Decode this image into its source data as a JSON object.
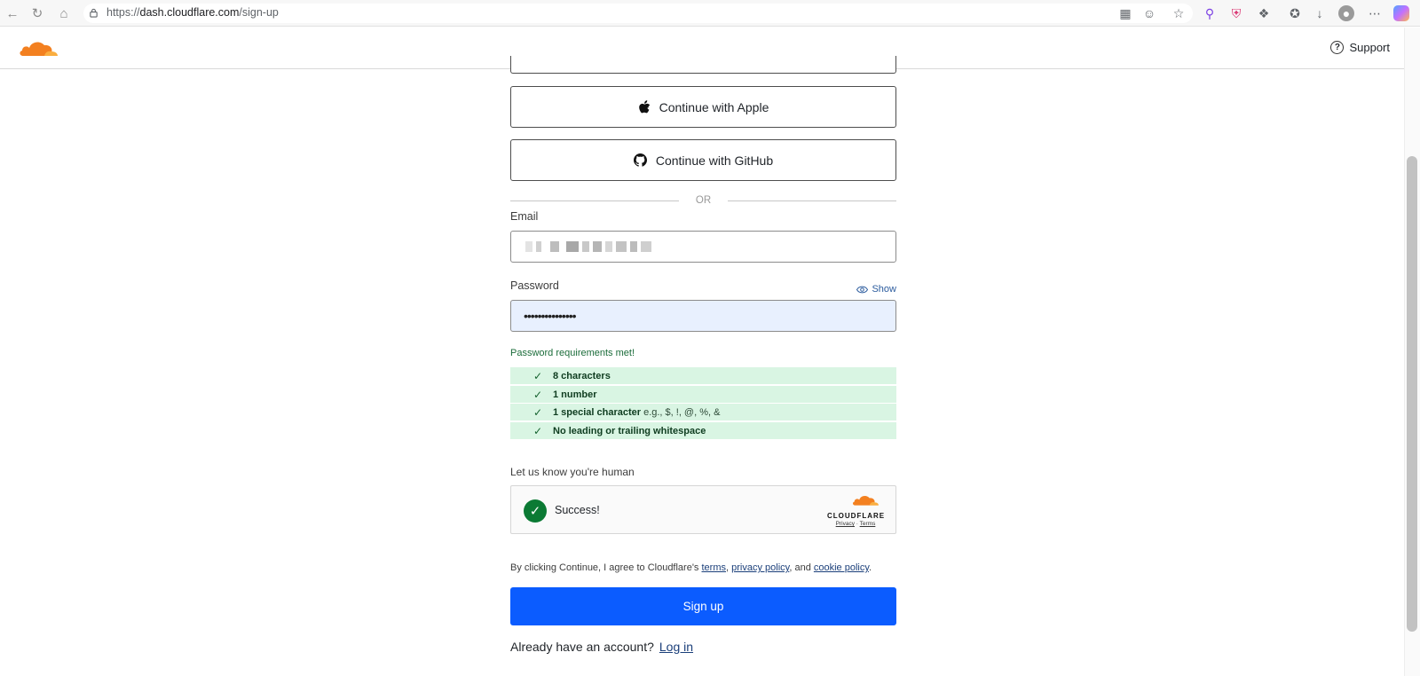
{
  "browser": {
    "url_scheme": "https://",
    "url_host": "dash.cloudflare.com",
    "url_path": "/sign-up"
  },
  "header": {
    "support_label": "Support"
  },
  "auth": {
    "apple_label": "Continue with Apple",
    "github_label": "Continue with GitHub",
    "divider_text": "OR"
  },
  "email": {
    "label": "Email"
  },
  "password": {
    "label": "Password",
    "show_label": "Show",
    "masked_value": "•••••••••••••••"
  },
  "requirements": {
    "title": "Password requirements met!",
    "items": [
      {
        "label": "8 characters",
        "example": ""
      },
      {
        "label": "1 number",
        "example": ""
      },
      {
        "label": "1 special character",
        "example": "e.g., $, !, @, %, &"
      },
      {
        "label": "No leading or trailing whitespace",
        "example": ""
      }
    ]
  },
  "captcha": {
    "prompt": "Let us know you're human",
    "status": "Success!",
    "brand": "CLOUDFLARE",
    "privacy": "Privacy",
    "sep": " · ",
    "terms": "Terms"
  },
  "legal": {
    "prefix": "By clicking Continue, I agree to Cloudflare's ",
    "terms": "terms",
    "comma": ", ",
    "privacy": "privacy policy",
    "and": ", and ",
    "cookie": "cookie policy",
    "suffix": "."
  },
  "signup_label": "Sign up",
  "login": {
    "prompt": "Already have an account?",
    "link": "Log in"
  },
  "colors": {
    "primary": "#0b5cff",
    "success": "#0b7a34",
    "req_bg": "#d9f5e3",
    "brand_orange": "#f38020"
  }
}
